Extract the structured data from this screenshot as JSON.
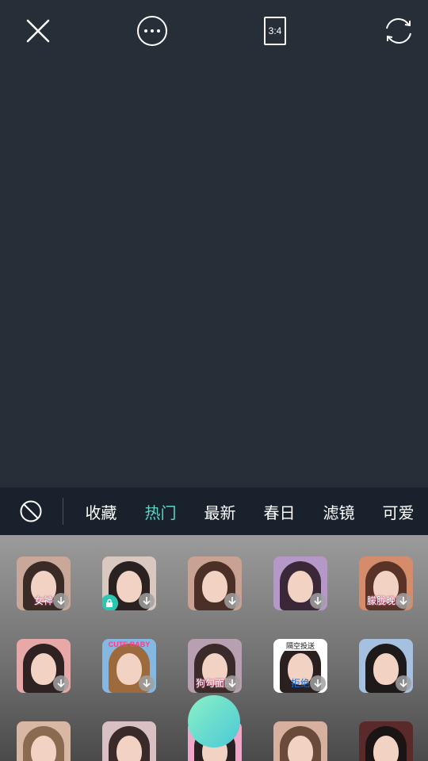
{
  "top_bar": {
    "close_icon": "close-icon",
    "more_icon": "more-icon",
    "ratio_label": "3:4",
    "flip_icon": "flip-camera-icon"
  },
  "tabs": [
    {
      "label": "收藏",
      "active": false
    },
    {
      "label": "热门",
      "active": true
    },
    {
      "label": "最新",
      "active": false
    },
    {
      "label": "春日",
      "active": false
    },
    {
      "label": "滤镜",
      "active": false
    },
    {
      "label": "可爱",
      "active": false
    }
  ],
  "accent_color": "#5fd3c3",
  "stickers": [
    {
      "caption": "女神",
      "bg": "#c9a89a",
      "hair": "#3b2b26"
    },
    {
      "caption": "",
      "bg": "#d9c8c0",
      "hair": "#2a2220",
      "locked": true
    },
    {
      "caption": "",
      "bg": "#c9a294",
      "hair": "#4a3026"
    },
    {
      "caption": "",
      "bg": "#b598c8",
      "hair": "#3a2838"
    },
    {
      "caption": "朦胧晚霞",
      "bg": "#d48c6a",
      "hair": "#5a3328"
    },
    {
      "caption": "",
      "bg": "#e8a8a8",
      "hair": "#2e2222"
    },
    {
      "caption": "",
      "bg": "#84b8e0",
      "hair": "#9c6a3c"
    },
    {
      "caption": "狗勾面膜",
      "bg": "#b8a0b0",
      "hair": "#3a2a2a"
    },
    {
      "caption": "拒绝",
      "bg": "#ffffff",
      "hair": "#2a2020"
    },
    {
      "caption": "",
      "bg": "#a6c0e0",
      "hair": "#1e1a1a"
    },
    {
      "caption": "",
      "bg": "#d8b8a4",
      "hair": "#8a6a50"
    },
    {
      "caption": "",
      "bg": "#d8c0c4",
      "hair": "#3a2a2a"
    },
    {
      "caption": "",
      "bg": "#f0a8c8",
      "hair": "#2a2222"
    },
    {
      "caption": "",
      "bg": "#d8b0a0",
      "hair": "#6a4a3a"
    },
    {
      "caption": "",
      "bg": "#5a2a2a",
      "hair": "#1a1414"
    }
  ],
  "extra_text": {
    "sticker_5_top": "隔空投送",
    "sticker_6_badge": "CUTE BABY"
  }
}
